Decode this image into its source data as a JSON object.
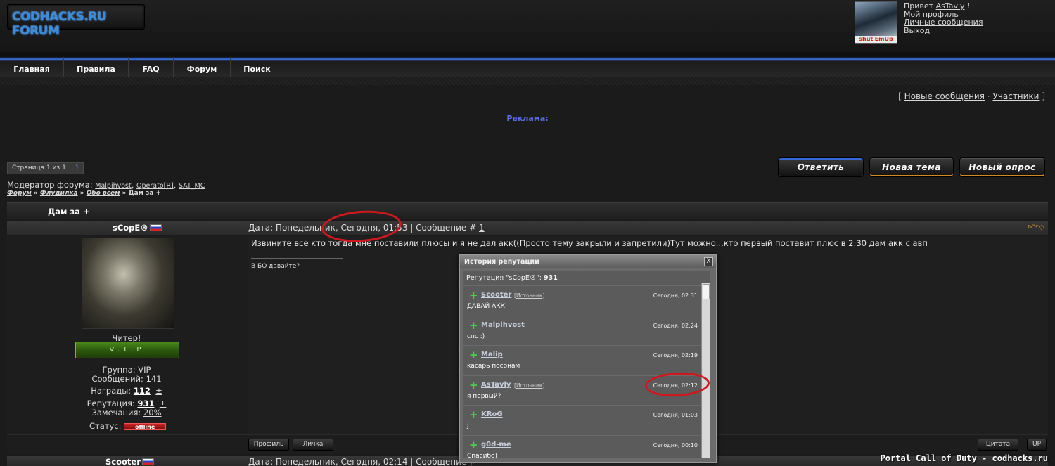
{
  "header": {
    "logo_text": "CODHACKS.RU FORUM",
    "avatar_caption": "shut'EmUp",
    "greeting_prefix": "Привет",
    "username": "AsTavly",
    "greeting_suffix": "!",
    "links": [
      "Мой профиль",
      "Личные сообщения",
      "Выход"
    ]
  },
  "nav": {
    "items": [
      "Главная",
      "Правила",
      "FAQ",
      "Форум",
      "Поиск"
    ]
  },
  "top_links": {
    "open": "[",
    "new_posts": "Новые сообщения",
    "sep": "·",
    "members": "Участники",
    "close": "]"
  },
  "ads_label": "Реклама:",
  "pager": {
    "label": "Страница 1 из 1",
    "current": "1"
  },
  "buttons": {
    "reply": "Ответить",
    "new_topic": "Новая тема",
    "new_poll": "Новый опрос"
  },
  "moderators": {
    "label": "Модератор форума:",
    "names": [
      "Malpihvost",
      "Operato[R]",
      "SAT_MC"
    ]
  },
  "breadcrumb": [
    "Форум",
    "Флудилка",
    "Обо всем",
    "Дам за +"
  ],
  "thread": {
    "title": "Дам за +"
  },
  "post": {
    "author": "sCopE®",
    "date_text": "Дата: Понедельник, Сегодня, 01:53 | Сообщение #",
    "post_number": "1",
    "body": "Извините все кто тогда мне поставили плюсы и я не дал акк((Просто тему закрыли и запретили)Тут можно...кто первый поставит плюс в 2:30 дам акк с авп",
    "signature": "В БО давайте?",
    "user": {
      "rank": "Читер!",
      "vip_label": "V.I.P",
      "group": "Группа: VIP",
      "messages": "Сообщений: 141",
      "awards_label": "Награды:",
      "awards_value": "112",
      "reputation_label": "Репутация:",
      "reputation_value": "931",
      "plusminus": "±",
      "warnings_label": "Замечания:",
      "warnings_value": "20%",
      "status_label": "Статус:",
      "status_value": "offline"
    },
    "footer": {
      "profile": "Профиль",
      "pm": "Личка",
      "quote": "Цитата",
      "up": "UP"
    }
  },
  "next_post": {
    "author": "Scooter",
    "date_text": "Дата: Понедельник, Сегодня, 02:14 | Сообщение #"
  },
  "reputation_popup": {
    "title": "История репутации",
    "close": "X",
    "summary_prefix": "Репутация \"sCopE®\":",
    "summary_value": "931",
    "entries": [
      {
        "user": "Scooter",
        "source": "Источник",
        "time": "Сегодня, 02:31",
        "comment": "ДАВАЙ АКК"
      },
      {
        "user": "Malpihvost",
        "source": "",
        "time": "Сегодня, 02:24",
        "comment": "спс :)"
      },
      {
        "user": "Malip",
        "source": "",
        "time": "Сегодня, 02:19",
        "comment": "касарь посонам"
      },
      {
        "user": "AsTavly",
        "source": "Источник",
        "time": "Сегодня, 02:12",
        "comment": "я первый?"
      },
      {
        "user": "KRoG",
        "source": "",
        "time": "Сегодня, 01:03",
        "comment": "j"
      },
      {
        "user": "g0d-me",
        "source": "",
        "time": "Сегодня, 00:10",
        "comment": "Спасибо)"
      }
    ]
  },
  "watermark": "Portal Call of Duty - codhacks.ru",
  "colors": {
    "accent_blue": "#3b6fd6",
    "annotation_red": "#d2161e",
    "rep_plus": "#4ad04a"
  }
}
